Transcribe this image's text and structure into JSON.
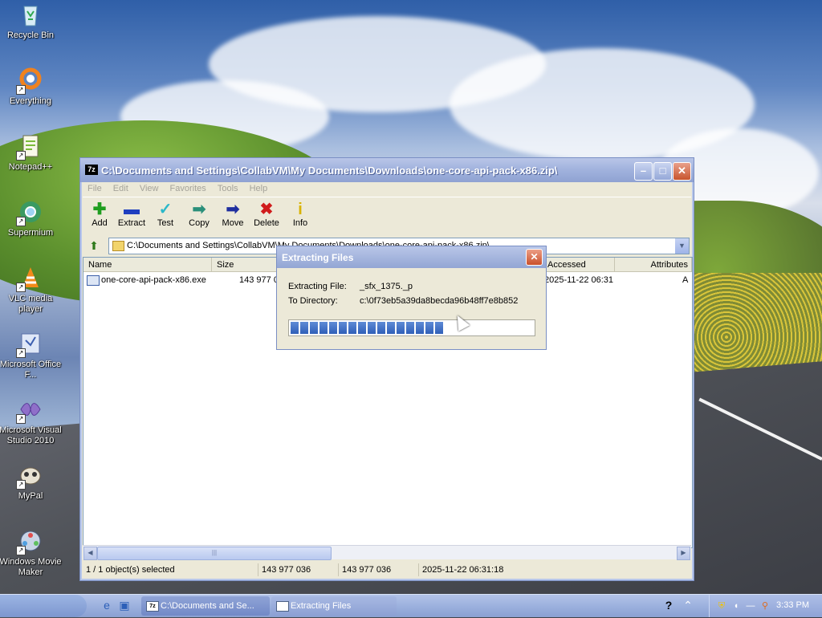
{
  "desktop": {
    "icons": [
      {
        "label": "Recycle Bin",
        "icon": "recycle-bin-icon"
      },
      {
        "label": "Everything",
        "icon": "everything-icon"
      },
      {
        "label": "Notepad++",
        "icon": "notepad-plus-plus-icon"
      },
      {
        "label": "Supermium",
        "icon": "supermium-icon"
      },
      {
        "label": "VLC media player",
        "icon": "vlc-icon"
      },
      {
        "label": "Microsoft Office F...",
        "icon": "office-icon"
      },
      {
        "label": "Microsoft Visual Studio 2010",
        "icon": "visual-studio-icon"
      },
      {
        "label": "MyPal",
        "icon": "mypal-icon"
      },
      {
        "label": "Windows Movie Maker",
        "icon": "movie-maker-icon"
      }
    ]
  },
  "window": {
    "app_badge": "7z",
    "title": "C:\\Documents and Settings\\CollabVM\\My Documents\\Downloads\\one-core-api-pack-x86.zip\\",
    "menu": [
      "File",
      "Edit",
      "View",
      "Favorites",
      "Tools",
      "Help"
    ],
    "toolbar": [
      {
        "label": "Add",
        "icon": "plus-icon",
        "color": "#1f9d1f"
      },
      {
        "label": "Extract",
        "icon": "minus-icon",
        "color": "#1f3fbf"
      },
      {
        "label": "Test",
        "icon": "checkmark-icon",
        "color": "#2bb8c9"
      },
      {
        "label": "Copy",
        "icon": "copy-arrow-icon",
        "color": "#2a8f7a"
      },
      {
        "label": "Move",
        "icon": "move-arrow-icon",
        "color": "#1f2f9f"
      },
      {
        "label": "Delete",
        "icon": "delete-x-icon",
        "color": "#d01b1b"
      },
      {
        "label": "Info",
        "icon": "info-icon",
        "color": "#d9b300"
      }
    ],
    "address": "C:\\Documents and Settings\\CollabVM\\My Documents\\Downloads\\one-core-api-pack-x86.zip\\",
    "columns": [
      "Name",
      "Size",
      "Accessed",
      "Attributes"
    ],
    "file": {
      "name": "one-core-api-pack-x86.exe",
      "size": "143 977 036",
      "accessed": "2025-11-22 06:31",
      "attributes": "A"
    },
    "status": {
      "selected": "1 / 1 object(s) selected",
      "size": "143 977 036",
      "packed": "143 977 036",
      "modified": "2025-11-22 06:31:18"
    }
  },
  "dialog": {
    "title": "Extracting Files",
    "file_label": "Extracting File:",
    "file_value": "_sfx_1375._p",
    "dir_label": "To Directory:",
    "dir_value": "c:\\0f73eb5a39da8becda96b48ff7e8b852",
    "progress": 0.62
  },
  "taskbar": {
    "tasks": [
      {
        "label": "C:\\Documents and Se...",
        "badge": "7z"
      },
      {
        "label": "Extracting Files",
        "badge": ""
      }
    ],
    "clock": "3:33 PM"
  }
}
